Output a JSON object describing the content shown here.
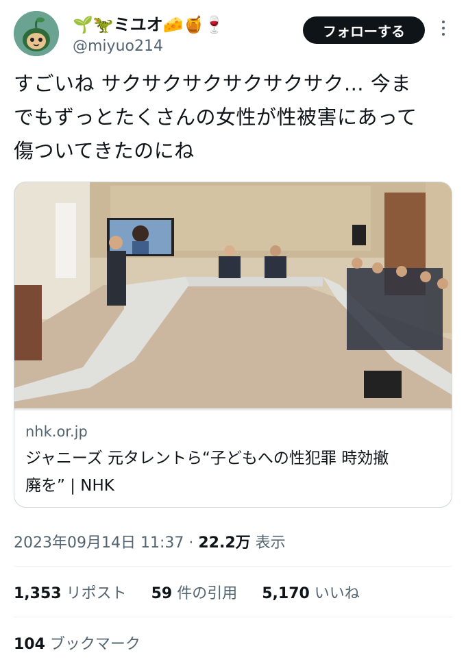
{
  "user": {
    "display_name": "🌱🦖ミユオ🧀🍯🍷",
    "handle": "@miyuo214"
  },
  "follow_label": "フォローする",
  "tweet_text": "すごいね サクサクサクサクサクサク… 今ま\nでもずっとたくさんの女性が性被害にあって\n傷ついてきたのにね",
  "link_card": {
    "domain": "nhk.or.jp",
    "title": "ジャニーズ 元タレントら“子どもへの性犯罪 時効撤\n廃を” | NHK"
  },
  "meta": {
    "timestamp": "2023年09月14日 11:37",
    "separator": " · ",
    "views": "22.2万",
    "views_label": " 表示"
  },
  "stats": {
    "reposts": "1,353",
    "reposts_label": " リポスト",
    "quotes": "59",
    "quotes_label": " 件の引用",
    "likes": "5,170",
    "likes_label": " いいね"
  },
  "bookmarks": {
    "count": "104",
    "label": " ブックマーク"
  },
  "colors": {
    "text": "#0f1419",
    "secondary": "#536471",
    "border": "#cfd9de",
    "button_bg": "#0f1419"
  },
  "icons": [
    "more-vertical-icon"
  ]
}
